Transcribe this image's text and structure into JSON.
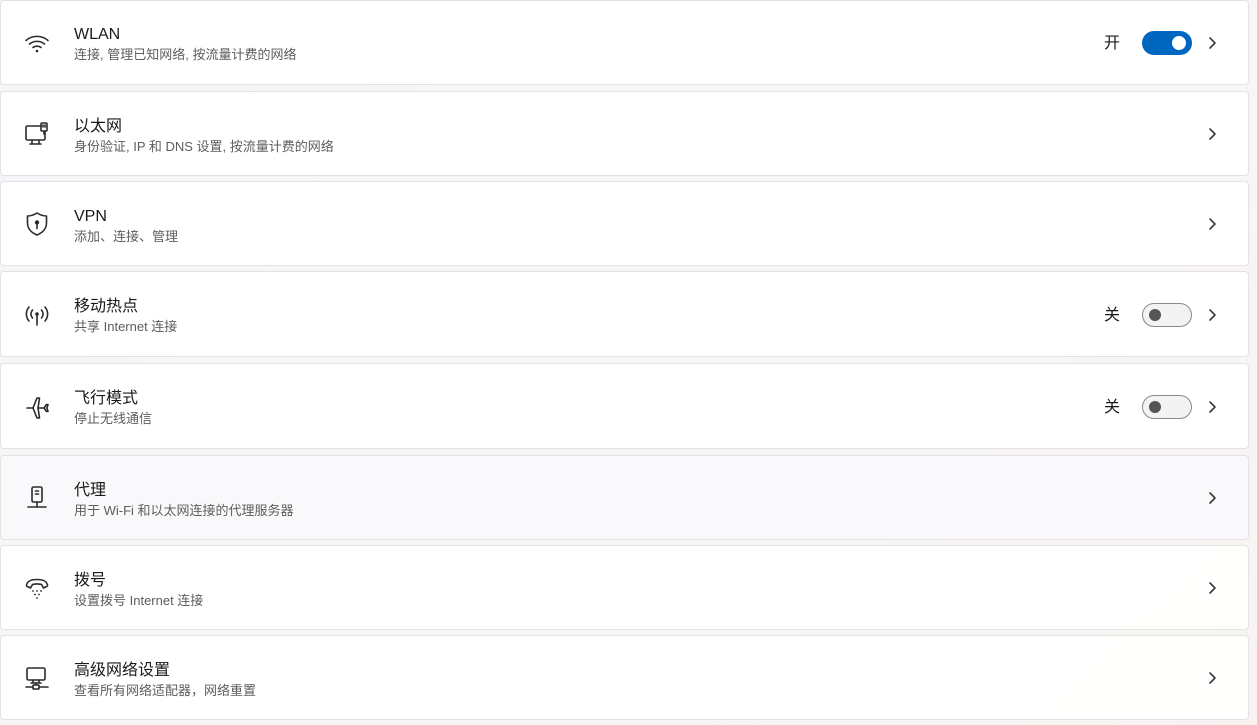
{
  "colors": {
    "accent": "#0067c0",
    "toggle_off_border": "#8a8a8a",
    "subtitle": "#5d5d5d"
  },
  "settings": [
    {
      "title": "WLAN",
      "subtitle": "连接, 管理已知网络, 按流量计费的网络",
      "icon": "wifi-icon",
      "toggle": "on",
      "state_label": "开"
    },
    {
      "title": "以太网",
      "subtitle": "身份验证, IP 和 DNS 设置, 按流量计费的网络",
      "icon": "ethernet-icon"
    },
    {
      "title": "VPN",
      "subtitle": "添加、连接、管理",
      "icon": "vpn-shield-icon"
    },
    {
      "title": "移动热点",
      "subtitle": "共享 Internet 连接",
      "icon": "hotspot-icon",
      "toggle": "off",
      "state_label": "关"
    },
    {
      "title": "飞行模式",
      "subtitle": "停止无线通信",
      "icon": "airplane-icon",
      "toggle": "off",
      "state_label": "关"
    },
    {
      "title": "代理",
      "subtitle": "用于 Wi-Fi 和以太网连接的代理服务器",
      "icon": "proxy-icon"
    },
    {
      "title": "拨号",
      "subtitle": "设置拨号 Internet 连接",
      "icon": "dialup-phone-icon"
    },
    {
      "title": "高级网络设置",
      "subtitle": "查看所有网络适配器，网络重置",
      "icon": "advanced-network-icon"
    }
  ]
}
